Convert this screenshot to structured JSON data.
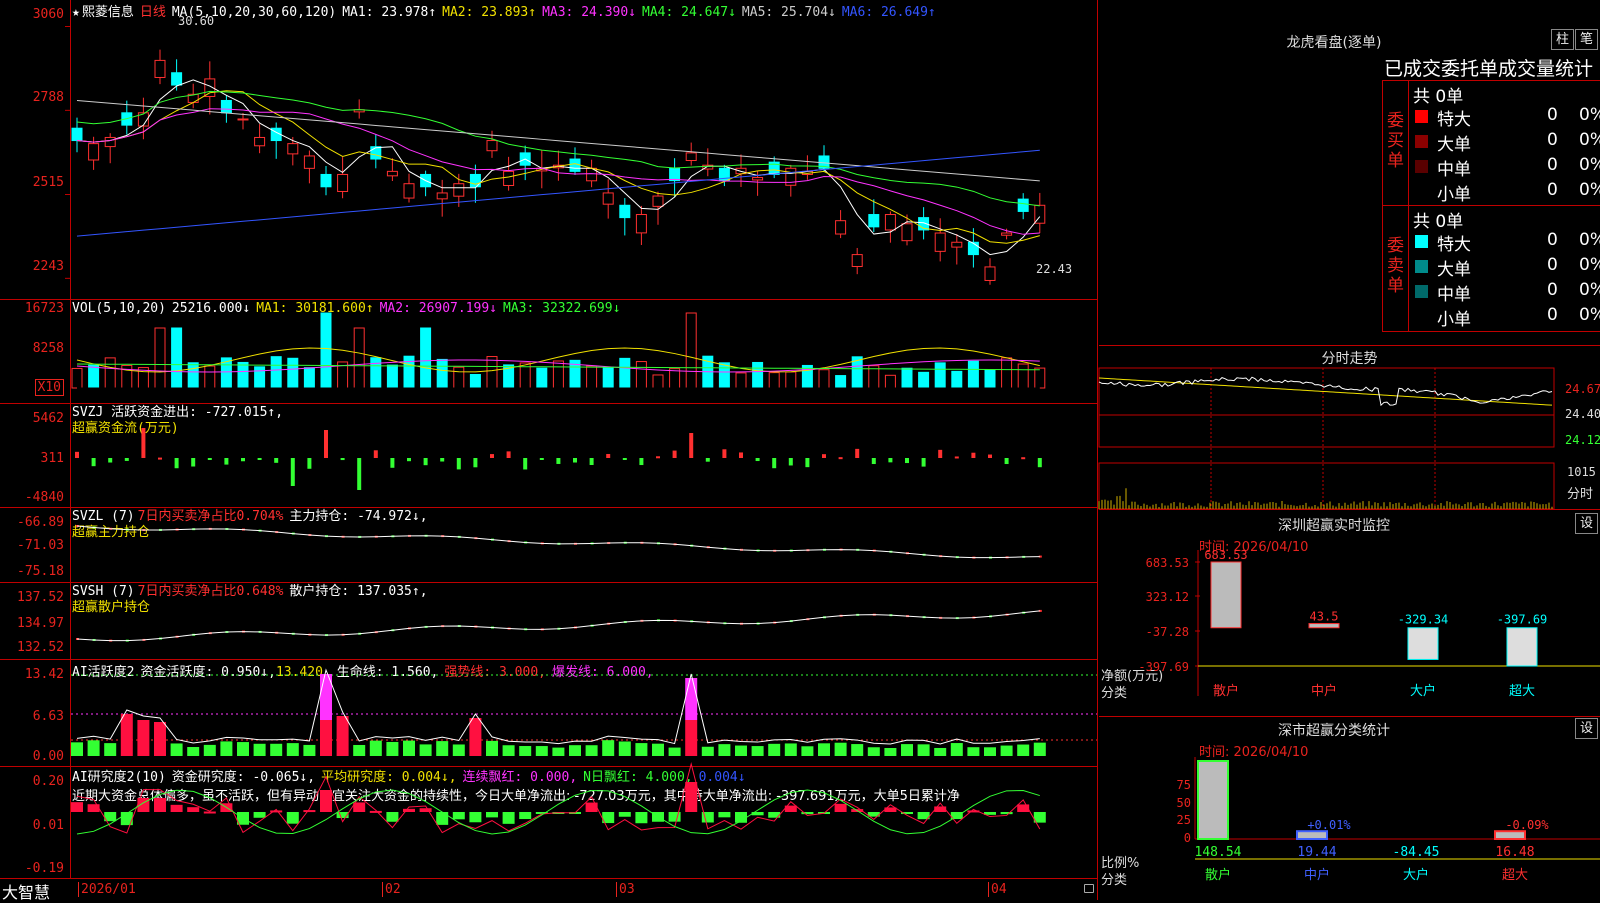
{
  "stock": {
    "star": "★",
    "name": "熙菱信息",
    "period": "日线"
  },
  "main": {
    "ma_label": "MA(5,10,20,30,60,120)",
    "ma": [
      {
        "text": "MA1: 23.978↑",
        "color": "#ffffff"
      },
      {
        "text": "MA2: 23.893↑",
        "color": "#f0e000"
      },
      {
        "text": "MA3: 24.390↓",
        "color": "#ff33ff"
      },
      {
        "text": "MA4: 24.647↓",
        "color": "#33ff33"
      },
      {
        "text": "MA5: 25.704↓",
        "color": "#cccccc"
      },
      {
        "text": "MA6: 26.649↑",
        "color": "#3355ff"
      }
    ],
    "y_ticks": [
      "3060",
      "2788",
      "2515",
      "2243"
    ],
    "y_values": [
      30.6,
      27.88,
      25.15,
      22.43
    ],
    "high_label": "30.60",
    "low_label": "22.43"
  },
  "vol": {
    "label": "VOL(5,10,20)",
    "value": "25216.000↓",
    "ma": [
      {
        "text": "MA1: 30181.600↑",
        "color": "#f0e000"
      },
      {
        "text": "MA2: 26907.199↓",
        "color": "#ff33ff"
      },
      {
        "text": "MA3: 32322.699↓",
        "color": "#33ff33"
      }
    ],
    "y_ticks": [
      "16723",
      "8258"
    ],
    "unit": "X10"
  },
  "svzj": {
    "line1": "SVZJ  活跃资金进出: -727.015↑,",
    "line2": "超赢资金流(万元)",
    "y_ticks": [
      "5462",
      "311",
      "-4840"
    ]
  },
  "svzl": {
    "prefix": "SVZL (7)",
    "red": "7日内买卖净占比0.704%",
    "rest": "主力持仓: -74.972↓,",
    "line2": "超赢主力持仓",
    "y_ticks": [
      "-66.89",
      "-71.03",
      "-75.18"
    ]
  },
  "svsh": {
    "prefix": "SVSH (7)",
    "red": "7日内买卖净占比0.648%",
    "rest": "散户持仓: 137.035↑,",
    "line2": "超赢散户持仓",
    "y_ticks": [
      "137.52",
      "134.97",
      "132.52"
    ]
  },
  "ai1": {
    "prefix": "AI活跃度2",
    "parts": [
      {
        "text": "资金活跃度: 0.950↓,",
        "color": "#ffffff"
      },
      {
        "text": "13.420,",
        "color": "#f0e000"
      },
      {
        "text": "生命线: 1.560,",
        "color": "#ffffff"
      },
      {
        "text": "强势线: 3.000,",
        "color": "#ff3030"
      },
      {
        "text": "爆发线: 6.000,",
        "color": "#ff33ff"
      }
    ],
    "y_ticks": [
      "13.42",
      "6.63",
      "0.00"
    ]
  },
  "ai2": {
    "prefix": "AI研究度2(10)",
    "parts": [
      {
        "text": "资金研究度: -0.065↓,",
        "color": "#ffffff"
      },
      {
        "text": "平均研究度: 0.004↓,",
        "color": "#f0e000"
      },
      {
        "text": "连续飘红: 0.000,",
        "color": "#ff33ff"
      },
      {
        "text": "N日飘红: 4.000,",
        "color": "#33ff33"
      },
      {
        "text": "0.004↓",
        "color": "#3355ff"
      }
    ],
    "comment": "近期大资金总体偏多，虽不活跃，但有异动，宜关注大资金的持续性，今日大单净流出: -727.03万元，其中特大单净流出: -397.691万元，大单5日累计净",
    "y_ticks": [
      "0.20",
      "0.01",
      "-0.19"
    ]
  },
  "xaxis": {
    "brand": "大智慧",
    "labels": [
      "2026/01",
      "02",
      "03",
      "04"
    ]
  },
  "dragon": {
    "title": "龙虎看盘(逐单)",
    "btn1": "柱",
    "btn2": "笔",
    "header": "已成交委托单成交量统计",
    "buy": {
      "side": [
        "委",
        "买",
        "单"
      ],
      "total": "共 0单",
      "rows": [
        {
          "label": "特大",
          "value": "0",
          "pct": "0%",
          "color": "#ff0000"
        },
        {
          "label": "大单",
          "value": "0",
          "pct": "0%",
          "color": "#8b0000"
        },
        {
          "label": "中单",
          "value": "0",
          "pct": "0%",
          "color": "#5a0000"
        },
        {
          "label": "小单",
          "value": "0",
          "pct": "0%",
          "color": "#000000"
        }
      ]
    },
    "sell": {
      "side": [
        "委",
        "卖",
        "单"
      ],
      "total": "共 0单",
      "rows": [
        {
          "label": "特大",
          "value": "0",
          "pct": "0%",
          "color": "#00ffff"
        },
        {
          "label": "大单",
          "value": "0",
          "pct": "0%",
          "color": "#008b8b"
        },
        {
          "label": "中单",
          "value": "0",
          "pct": "0%",
          "color": "#006a6a"
        },
        {
          "label": "小单",
          "value": "0",
          "pct": "0%",
          "color": "#000000"
        }
      ]
    }
  },
  "intraday": {
    "title": "分时走势",
    "y_labels": [
      "24.67",
      "24.40",
      "24.12"
    ],
    "vol_label": "1015",
    "tag": "分时"
  },
  "monitor": {
    "title": "深圳超赢实时监控",
    "set_btn": "设",
    "time": "时间: 2026/04/10",
    "y_ticks": [
      "683.53",
      "323.12",
      "-37.28",
      "-397.69"
    ],
    "ylabel": "净额(万元)",
    "xlabel": "分类",
    "bars": [
      {
        "name": "散户",
        "value": 683.53,
        "label": "683.53"
      },
      {
        "name": "中户",
        "value": 43.5,
        "label": "43.5"
      },
      {
        "name": "大户",
        "value": -329.34,
        "label": "-329.34"
      },
      {
        "name": "超大",
        "value": -397.69,
        "label": "-397.69"
      }
    ]
  },
  "classify": {
    "title": "深市超赢分类统计",
    "set_btn": "设",
    "time": "时间: 2026/04/10",
    "y_ticks": [
      "75",
      "50",
      "25",
      "0"
    ],
    "ylabel": "比例%",
    "xlabel": "分类",
    "bars": [
      {
        "name": "散户",
        "value": 100,
        "bottom": "148.54",
        "top": ""
      },
      {
        "name": "中户",
        "value": 10,
        "bottom": "19.44",
        "top": "+0.01%"
      },
      {
        "name": "大户",
        "value": 0,
        "bottom": "-84.45",
        "top": ""
      },
      {
        "name": "超大",
        "value": 10,
        "bottom": "16.48",
        "top": "-0.09%"
      }
    ]
  }
}
